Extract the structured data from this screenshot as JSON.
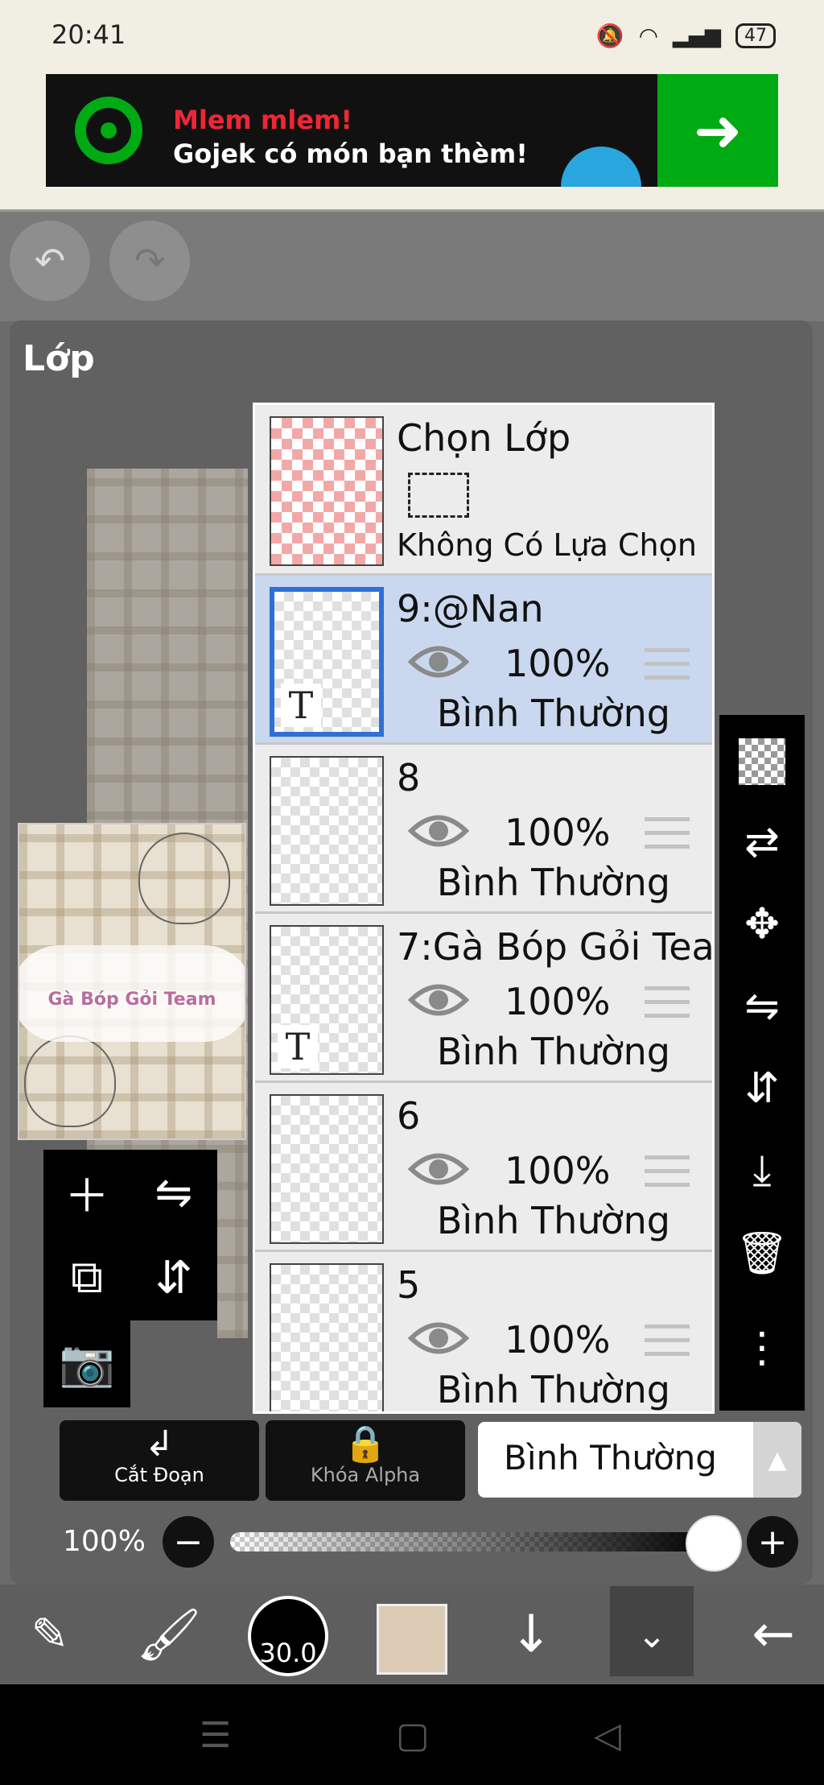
{
  "status_bar": {
    "time": "20:41",
    "battery": "47"
  },
  "ad": {
    "line1": "Mlem mlem!",
    "line2": "Gojek có món bạn thèm!"
  },
  "panel": {
    "title": "Lớp"
  },
  "preview": {
    "title": "Gà Bóp Gỏi Team"
  },
  "selection_layer": {
    "label": "Chọn Lớp",
    "status": "Không Có Lựa Chọn"
  },
  "layers": [
    {
      "name": "9:@Nan",
      "opacity": "100%",
      "blend": "Bình Thường",
      "selected": true,
      "text_layer": true
    },
    {
      "name": "8",
      "opacity": "100%",
      "blend": "Bình Thường",
      "selected": false,
      "text_layer": false
    },
    {
      "name": "7:Gà Bóp Gỏi Tea",
      "opacity": "100%",
      "blend": "Bình Thường",
      "selected": false,
      "text_layer": true
    },
    {
      "name": "6",
      "opacity": "100%",
      "blend": "Bình Thường",
      "selected": false,
      "text_layer": false
    },
    {
      "name": "5",
      "opacity": "100%",
      "blend": "Bình Thường",
      "selected": false,
      "text_layer": false
    }
  ],
  "bottom_controls": {
    "clip_label": "Cắt Đoạn",
    "alpha_lock_label": "Khóa Alpha",
    "blend_mode": "Bình Thường",
    "opacity_label": "100%",
    "opacity_value": 1.0
  },
  "toolbar": {
    "brush_size": "30.0",
    "color": "#dccbb5"
  },
  "icons": {
    "undo": "undo-icon",
    "redo": "redo-icon",
    "eye": "eye-icon",
    "right_tools": [
      "transparency-icon",
      "swap-icon",
      "move-icon",
      "flip-h-icon",
      "flip-v-icon",
      "merge-down-icon",
      "trash-icon",
      "more-icon"
    ]
  }
}
